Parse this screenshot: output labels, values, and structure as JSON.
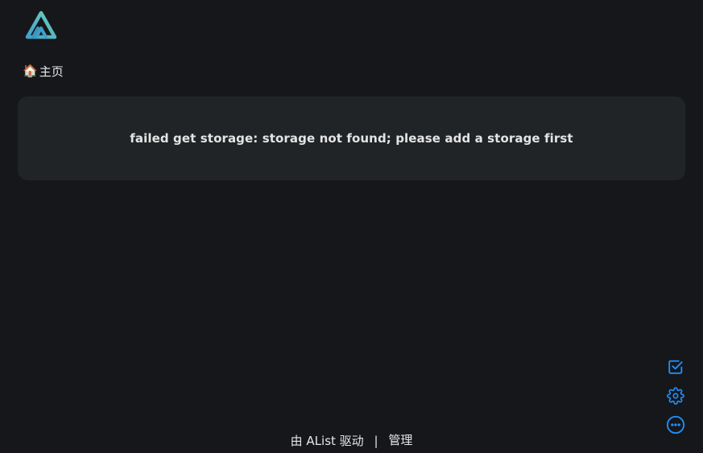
{
  "header": {
    "logo_icon": "alist-logo-icon"
  },
  "breadcrumb": {
    "home_icon": "🏠",
    "home_label": "主页"
  },
  "main": {
    "error_message": "failed get storage: storage not found; please add a storage first"
  },
  "tools": {
    "icons": [
      "checkbox-icon",
      "gear-icon",
      "more-icon"
    ],
    "accent_color": "#1e90ff"
  },
  "footer": {
    "powered_by": "由 AList 驱动",
    "separator": "|",
    "manage_link": "管理"
  },
  "colors": {
    "background": "#16171a",
    "card": "#212426",
    "logo_teal": "#4fb5c4"
  }
}
